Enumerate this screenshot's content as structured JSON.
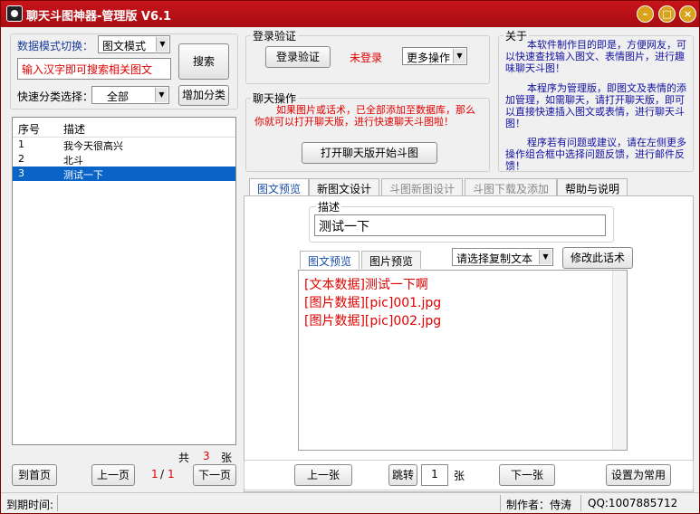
{
  "window": {
    "title": "聊天斗图神器-管理版 V6.1"
  },
  "left": {
    "mode_label": "数据模式切换：",
    "mode_value": "图文模式",
    "search_button": "搜索",
    "search_placeholder": "输入汉字即可搜索相关图文",
    "category_label": "快速分类选择：",
    "category_value": "全部",
    "add_category_button": "增加分类",
    "list": {
      "headers": [
        "序号",
        "描述"
      ],
      "rows": [
        {
          "no": "1",
          "desc": "我今天很高兴"
        },
        {
          "no": "2",
          "desc": "北斗"
        },
        {
          "no": "3",
          "desc": "测试一下"
        }
      ],
      "selected_index": 2
    },
    "total_prefix": "共",
    "total_count": "3",
    "total_suffix": "张",
    "first_page": "到首页",
    "prev_page": "上一页",
    "page_current": "1",
    "page_sep": "/",
    "page_total": "1",
    "next_page": "下一页"
  },
  "login": {
    "group_title": "登录验证",
    "verify_button": "登录验证",
    "status": "未登录",
    "more_ops": "更多操作"
  },
  "chat": {
    "group_title": "聊天操作",
    "message": "如果图片或话术，已全部添加至数据库，那么你就可以打开聊天版，进行快速聊天斗图啦！",
    "open_button": "打开聊天版开始斗图"
  },
  "about": {
    "group_title": "关于",
    "text1": "本软件制作目的即是，方便网友，可以快速查找输入图文、表情图片，进行趣味聊天斗图！",
    "text2": "本程序为管理版，即图文及表情的添加管理，如需聊天，请打开聊天版，即可以直接快速插入图文或表情，进行聊天斗图！",
    "text3": "程序若有问题或建议，请在左侧更多操作组合框中选择问题反馈，进行邮件反馈！"
  },
  "tabs": [
    {
      "label": "图文预览",
      "state": "active"
    },
    {
      "label": "新图文设计",
      "state": "normal"
    },
    {
      "label": "斗图新图设计",
      "state": "disabled"
    },
    {
      "label": "斗图下载及添加",
      "state": "disabled"
    },
    {
      "label": "帮助与说明",
      "state": "normal"
    }
  ],
  "preview": {
    "desc_title": "描述",
    "desc_value": "测试一下",
    "subtabs": [
      "图文预览",
      "图片预览"
    ],
    "copy_select": "请选择复制文本",
    "edit_button": "修改此话术",
    "content_lines": [
      "[文本数据]测试一下啊",
      "[图片数据][pic]001.jpg",
      "[图片数据][pic]002.jpg"
    ],
    "prev_button": "上一张",
    "jump_button": "跳转",
    "jump_value": "1",
    "jump_unit": "张",
    "next_button": "下一张",
    "set_common_button": "设置为常用"
  },
  "status": {
    "expire_label": "到期时间:",
    "author": "制作者：侍涛",
    "qq": "QQ:1007885712"
  }
}
